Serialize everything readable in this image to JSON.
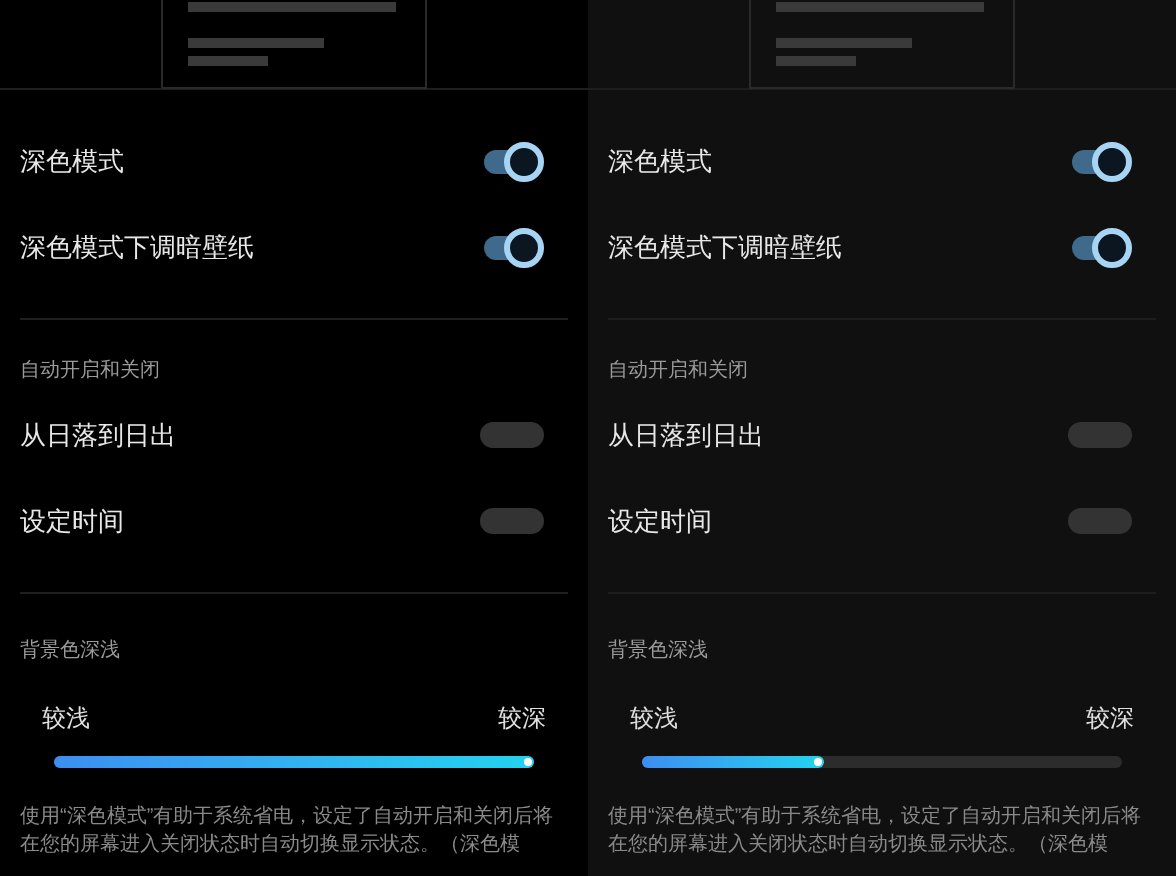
{
  "panels": [
    {
      "color": "#000000",
      "display": [
        {
          "label": "深色模式",
          "on": true
        },
        {
          "label": "深色模式下调暗壁纸",
          "on": true
        }
      ],
      "auto_heading": "自动开启和关闭",
      "auto": [
        {
          "label": "从日落到日出",
          "on": false
        },
        {
          "label": "设定时间",
          "on": false
        }
      ],
      "shade": {
        "heading": "背景色深浅",
        "min_label": "较浅",
        "max_label": "较深",
        "level": 1
      },
      "description": "使用“深色模式”有助于系统省电，设定了自动开启和关闭后将在您的屏幕进入关闭状态时自动切换显示状态。（深色模"
    },
    {
      "color": "#101010",
      "display": [
        {
          "label": "深色模式",
          "on": true
        },
        {
          "label": "深色模式下调暗壁纸",
          "on": true
        }
      ],
      "auto_heading": "自动开启和关闭",
      "auto": [
        {
          "label": "从日落到日出",
          "on": false
        },
        {
          "label": "设定时间",
          "on": false
        }
      ],
      "shade": {
        "heading": "背景色深浅",
        "min_label": "较浅",
        "max_label": "较深",
        "level": 0.38
      },
      "description": "使用“深色模式”有助于系统省电，设定了自动开启和关闭后将在您的屏幕进入关闭状态时自动切换显示状态。（深色模"
    }
  ]
}
